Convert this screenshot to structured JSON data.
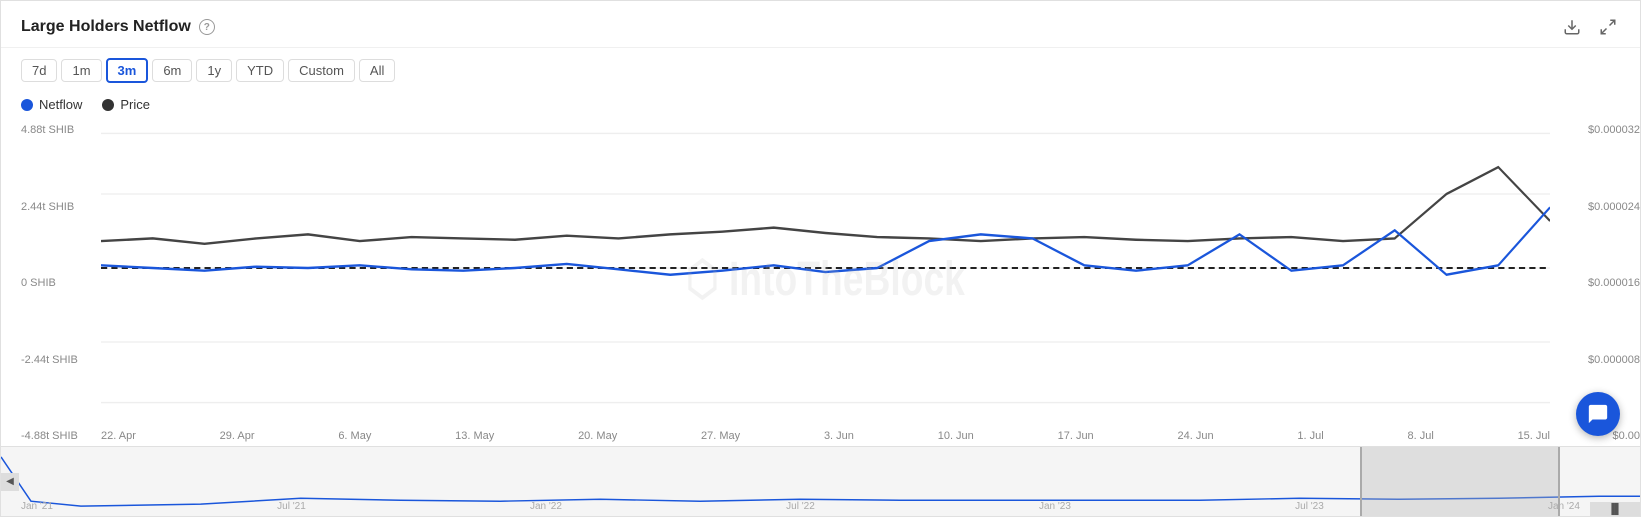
{
  "header": {
    "title": "Large Holders Netflow",
    "help_label": "?",
    "download_icon": "⬇",
    "expand_icon": "⤢"
  },
  "timeButtons": [
    {
      "label": "7d",
      "id": "7d",
      "active": false
    },
    {
      "label": "1m",
      "id": "1m",
      "active": false
    },
    {
      "label": "3m",
      "id": "3m",
      "active": true
    },
    {
      "label": "6m",
      "id": "6m",
      "active": false
    },
    {
      "label": "1y",
      "id": "1y",
      "active": false
    },
    {
      "label": "YTD",
      "id": "ytd",
      "active": false
    },
    {
      "label": "Custom",
      "id": "custom",
      "active": false
    },
    {
      "label": "All",
      "id": "all",
      "active": false
    }
  ],
  "legend": [
    {
      "label": "Netflow",
      "color": "#1a56db"
    },
    {
      "label": "Price",
      "color": "#333"
    }
  ],
  "yAxisLeft": [
    "4.88t SHIB",
    "2.44t SHIB",
    "0 SHIB",
    "-2.44t SHIB",
    "-4.88t SHIB"
  ],
  "yAxisRight": [
    "$0.000032",
    "$0.000024",
    "$0.000016",
    "$0.000008",
    "$0.00"
  ],
  "xAxisLabels": [
    "22. Apr",
    "29. Apr",
    "6. May",
    "13. May",
    "20. May",
    "27. May",
    "3. Jun",
    "10. Jun",
    "17. Jun",
    "24. Jun",
    "1. Jul",
    "8. Jul",
    "15. Jul"
  ],
  "minimapXLabels": [
    "Jan '21",
    "Jul '21",
    "Jan '22",
    "Jul '22",
    "Jan '23",
    "Jul '23",
    "Jan '24"
  ],
  "watermark": "IntoTheBlock",
  "chatButton": "💬"
}
